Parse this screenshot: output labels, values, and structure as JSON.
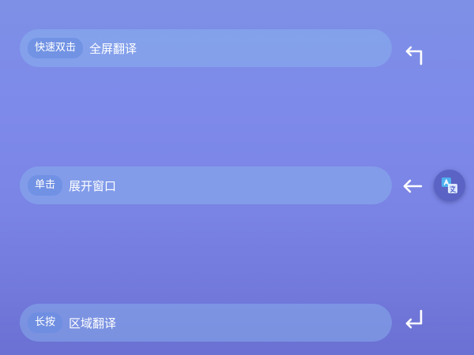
{
  "gestures": [
    {
      "trigger": "快速双击",
      "action": "全屏翻译",
      "direction_icon": "corner-up-left-arrow-icon"
    },
    {
      "trigger": "单击",
      "action": "展开窗口",
      "direction_icon": "left-arrow-icon"
    },
    {
      "trigger": "长按",
      "action": "区域翻译",
      "direction_icon": "corner-down-left-arrow-icon"
    }
  ],
  "floating_button": {
    "icon": "translate-icon"
  },
  "colors": {
    "background_top": "#7d90e6",
    "background_bottom": "#6b70d3",
    "pill": "#8cb9f0",
    "badge": "#698ce1",
    "floating_button": "#5b63c4",
    "text": "#ffffff"
  }
}
